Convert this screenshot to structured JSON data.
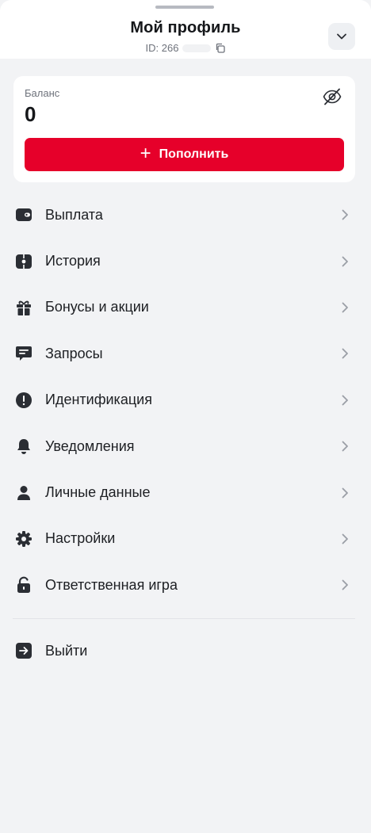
{
  "header": {
    "title": "Мой профиль",
    "id_label": "ID: 266"
  },
  "balance": {
    "label": "Баланс",
    "value": "0",
    "topup_label": "Пополнить"
  },
  "menu": {
    "items": [
      {
        "label": "Выплата",
        "icon": "wallet-icon"
      },
      {
        "label": "История",
        "icon": "history-icon"
      },
      {
        "label": "Бонусы и акции",
        "icon": "gift-icon"
      },
      {
        "label": "Запросы",
        "icon": "chat-icon"
      },
      {
        "label": "Идентификация",
        "icon": "alert-icon"
      },
      {
        "label": "Уведомления",
        "icon": "bell-icon"
      },
      {
        "label": "Личные данные",
        "icon": "user-icon"
      },
      {
        "label": "Настройки",
        "icon": "gear-icon"
      },
      {
        "label": "Ответственная игра",
        "icon": "lock-icon"
      }
    ]
  },
  "logout": {
    "label": "Выйти",
    "icon": "logout-icon"
  },
  "colors": {
    "accent": "#e6002a",
    "background": "#f2f3f5",
    "icon": "#2b2e34",
    "chevron": "#9a9ea6"
  }
}
